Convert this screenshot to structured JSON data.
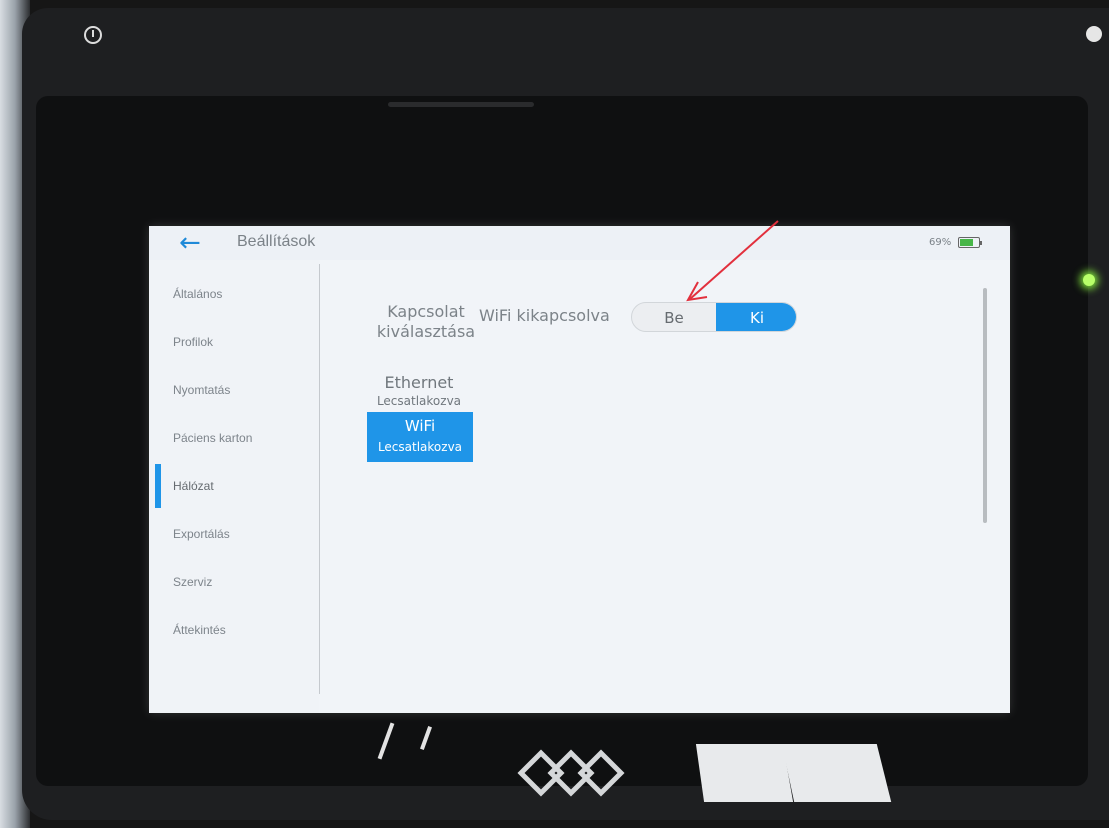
{
  "header": {
    "back_icon": "back-arrow-icon",
    "title": "Beállítások",
    "battery": "69%"
  },
  "sidebar": {
    "items": [
      {
        "label": "Általános"
      },
      {
        "label": "Profilok"
      },
      {
        "label": "Nyomtatás"
      },
      {
        "label": "Páciens karton"
      },
      {
        "label": "Hálózat",
        "active": true
      },
      {
        "label": "Exportálás"
      },
      {
        "label": "Szerviz"
      },
      {
        "label": "Áttekintés"
      }
    ]
  },
  "network": {
    "connection_label": "Kapcsolat kiválasztása",
    "wifi_status": "WiFi kikapcsolva",
    "toggle": {
      "on": "Be",
      "off": "Ki",
      "selected": "Ki"
    },
    "options": [
      {
        "name": "Ethernet",
        "status": "Lecsatlakozva",
        "selected": false
      },
      {
        "name": "WiFi",
        "status": "Lecsatlakozva",
        "selected": true
      }
    ]
  },
  "colors": {
    "accent": "#1f95e8",
    "screen_background": "#f1f4f8",
    "annotation_arrow": "#e2303d"
  }
}
